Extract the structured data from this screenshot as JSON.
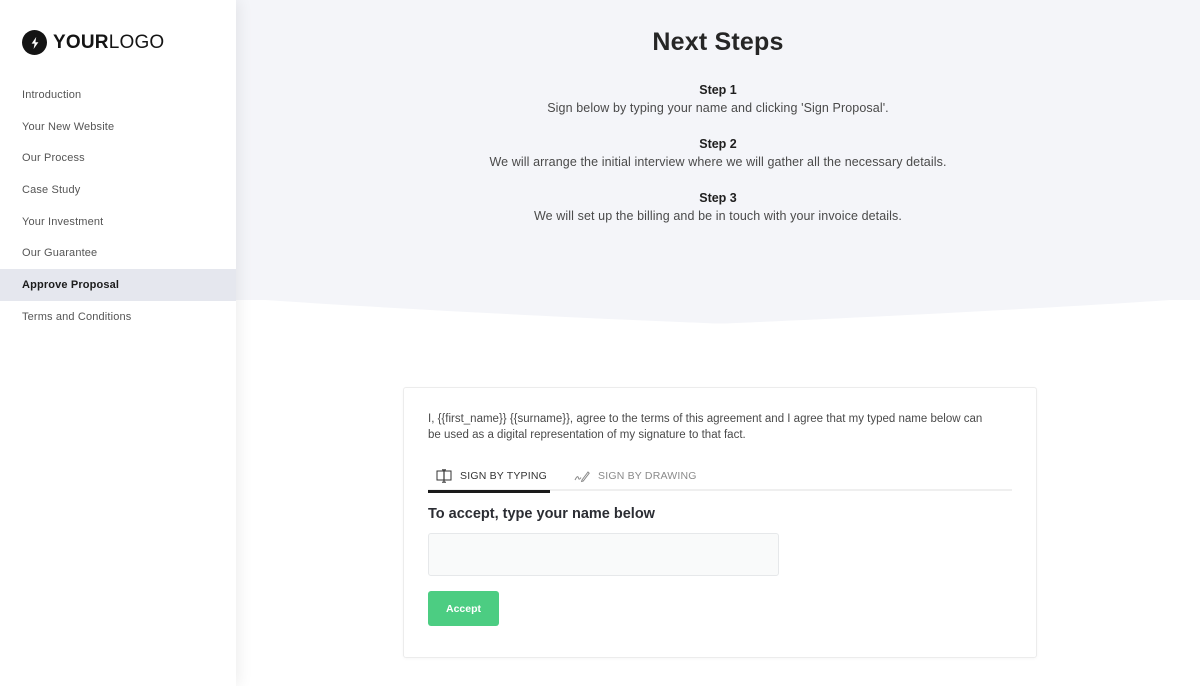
{
  "logo": {
    "icon": "lightning-bolt-icon",
    "text_bold": "YOUR",
    "text_light": "LOGO"
  },
  "sidebar": {
    "items": [
      {
        "label": "Introduction",
        "active": false
      },
      {
        "label": "Your New Website",
        "active": false
      },
      {
        "label": "Our Process",
        "active": false
      },
      {
        "label": "Case Study",
        "active": false
      },
      {
        "label": "Your Investment",
        "active": false
      },
      {
        "label": "Our Guarantee",
        "active": false
      },
      {
        "label": "Approve Proposal",
        "active": true
      },
      {
        "label": "Terms and Conditions",
        "active": false
      }
    ]
  },
  "hero": {
    "title": "Next Steps",
    "steps": [
      {
        "title": "Step 1",
        "text": "Sign below by typing your name and clicking 'Sign Proposal'."
      },
      {
        "title": "Step 2",
        "text": "We will arrange the initial interview where we will gather all the necessary details."
      },
      {
        "title": "Step 3",
        "text": "We will set up the billing and be in touch with your invoice details."
      }
    ]
  },
  "signature": {
    "agreement_text": "I, {{first_name}} {{surname}}, agree to the terms of this agreement and I agree that my typed name below can be used as a digital representation of my signature to that fact.",
    "tabs": [
      {
        "label": "SIGN BY TYPING",
        "icon": "text-cursor-icon",
        "active": true
      },
      {
        "label": "SIGN BY DRAWING",
        "icon": "pen-signature-icon",
        "active": false
      }
    ],
    "heading": "To accept, type your name below",
    "name_value": "",
    "name_placeholder": "",
    "accept_label": "Accept"
  },
  "colors": {
    "accent_green": "#4ccd82",
    "hero_bg": "#f4f5f9",
    "sidebar_active_bg": "#e5e7ee"
  }
}
